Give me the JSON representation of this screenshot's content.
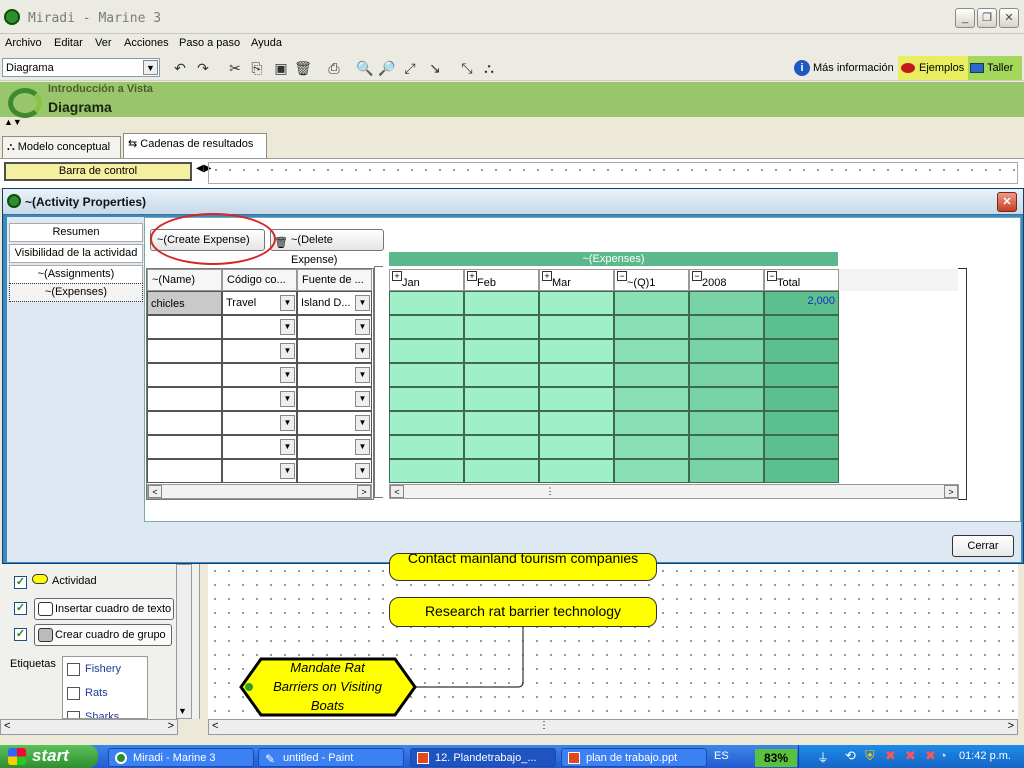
{
  "window": {
    "title": "Miradi - Marine 3"
  },
  "menu": [
    "Archivo",
    "Editar",
    "Ver",
    "Acciones",
    "Paso a paso",
    "Ayuda"
  ],
  "toolbar": {
    "view_select": "Diagrama",
    "mas_info": "Más información",
    "ejemplos": "Ejemplos",
    "taller": "Taller"
  },
  "banner": {
    "subtitle": "Introducción a Vista",
    "title": "Diagrama"
  },
  "tabs": [
    {
      "label": "Modelo conceptual",
      "active": false
    },
    {
      "label": "Cadenas de resultados",
      "active": true
    }
  ],
  "control_bar": "Barra de control",
  "dialog": {
    "title": "~(Activity Properties)",
    "nav": [
      "Resumen",
      "Visibilidad de la actividad",
      "~(Assignments)",
      "~(Expenses)"
    ],
    "buttons": {
      "create": "~(Create Expense)",
      "delete": "~(Delete Expense)",
      "close": "Cerrar"
    },
    "left_columns": [
      "~(Name)",
      "Código co...",
      "Fuente de ..."
    ],
    "rows": [
      {
        "name": "chicles",
        "code": "Travel",
        "source": "Island D..."
      }
    ],
    "expenses_group": "~(Expenses)",
    "periods": [
      {
        "label": "Jan",
        "box": "+"
      },
      {
        "label": "Feb",
        "box": "+"
      },
      {
        "label": "Mar",
        "box": "+"
      },
      {
        "label": "~(Q)1",
        "box": "−"
      },
      {
        "label": "2008",
        "box": "−"
      },
      {
        "label": "Total",
        "box": "−"
      }
    ],
    "total_value": "2,000"
  },
  "legend": {
    "items": [
      "Actividad",
      "Insertar cuadro de texto",
      "Crear cuadro de grupo"
    ],
    "etiquetas_label": "Etiquetas",
    "tags": [
      "Fishery",
      "Rats",
      "Sharks"
    ]
  },
  "diagram": {
    "node_top": "Contact mainland tourism companies",
    "node_mid": "Research rat barrier technology",
    "node_hex": "Mandate Rat Barriers on Visiting Boats"
  },
  "taskbar": {
    "start": "start",
    "tasks": [
      "Miradi - Marine 3",
      "untitled - Paint",
      "12. Plandetrabajo_...",
      "plan de trabajo.ppt"
    ],
    "lang": "ES",
    "battery": "83%",
    "clock": "01:42 p.m."
  },
  "colors": {
    "accent_green": "#99c66b",
    "dialog_blue": "#3a8ac2",
    "cell_green": "#8fe0b8",
    "node_yellow": "#ffff00"
  }
}
